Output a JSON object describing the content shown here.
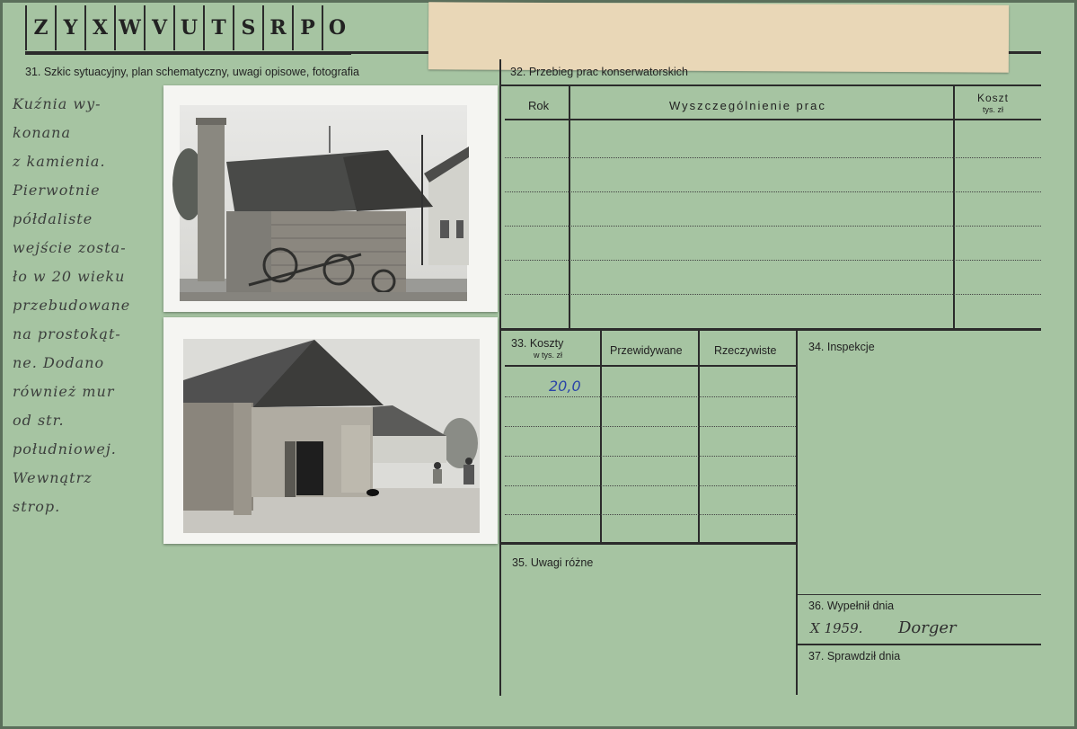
{
  "header": {
    "letters": [
      "Z",
      "Y",
      "X",
      "W",
      "V",
      "U",
      "T",
      "S",
      "R",
      "P",
      "O"
    ]
  },
  "section31": {
    "label": "31. Szkic sytuacyjny, plan schematyczny, uwagi opisowe, fotografia",
    "handwriting": [
      "Kuźnia wy-",
      "konana",
      "z kamienia.",
      "Pierwotnie",
      "półdaliste",
      "wejście zosta-",
      "ło w 20 wieku",
      "przebudowane",
      "na prostokąt-",
      "ne. Dodano",
      "również mur",
      "od str.",
      "południowej.",
      "Wewnątrz",
      "strop."
    ]
  },
  "section32": {
    "label": "32. Przebieg prac konserwatorskich",
    "col_rok": "Rok",
    "col_prac": "Wyszczególnienie prac",
    "col_koszt": "Koszt",
    "col_koszt_unit": "tys. zł"
  },
  "section33": {
    "label": "33. Koszty",
    "unit": "w tys. zł",
    "col_przewidywane": "Przewidywane",
    "col_rzeczywiste": "Rzeczywiste",
    "value": "20,0"
  },
  "section34": {
    "label": "34. Inspekcje"
  },
  "section35": {
    "label": "35. Uwagi różne"
  },
  "section36": {
    "label": "36. Wypełnił dnia",
    "date": "X 1959.",
    "signature": "Dorger"
  },
  "section37": {
    "label": "37. Sprawdził dnia"
  }
}
